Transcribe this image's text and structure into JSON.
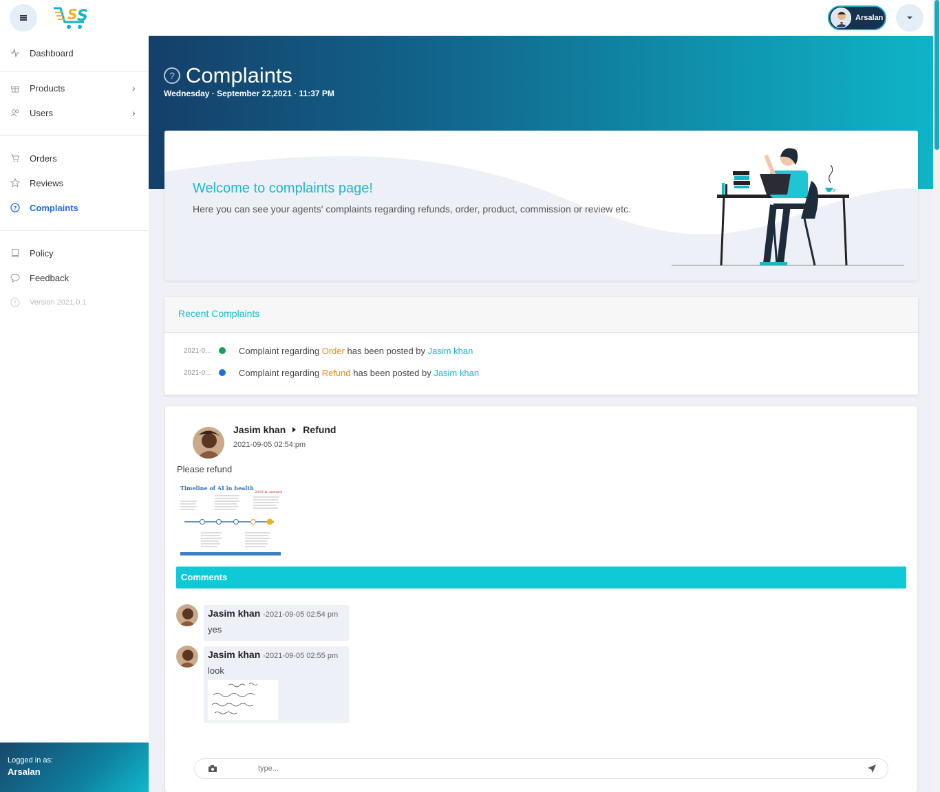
{
  "header": {
    "user_name": "Arsalan"
  },
  "sidebar": {
    "items": [
      {
        "label": "Dashboard",
        "icon": "pulse-icon"
      },
      {
        "label": "Products",
        "icon": "gift-icon",
        "has_submenu": true
      },
      {
        "label": "Users",
        "icon": "users-icon",
        "has_submenu": true
      },
      {
        "label": "Orders",
        "icon": "cart-icon"
      },
      {
        "label": "Reviews",
        "icon": "star-icon"
      },
      {
        "label": "Complaints",
        "icon": "help-circle-icon",
        "active": true
      },
      {
        "label": "Policy",
        "icon": "book-icon"
      },
      {
        "label": "Feedback",
        "icon": "chat-icon"
      },
      {
        "label": "Version 2021.0.1",
        "icon": "info-icon"
      }
    ],
    "logged_in_label": "Logged in as:",
    "logged_in_user": "Arsalan"
  },
  "page": {
    "title": "Complaints",
    "date": "Wednesday · September 22,2021 · 11:37 PM"
  },
  "welcome": {
    "heading": "Welcome to complaints page!",
    "text": "Here you can see your agents' complaints regarding refunds, order, product, commission or review etc."
  },
  "recent": {
    "title": "Recent Complaints",
    "items": [
      {
        "date": "2021-0...",
        "prefix": "Complaint regarding ",
        "type": "Order",
        "middle": " has been posted by ",
        "author": "Jasim khan",
        "dot_color": "#16a05a"
      },
      {
        "date": "2021-0...",
        "prefix": "Complaint regarding ",
        "type": "Refund",
        "middle": " has been posted by ",
        "author": "Jasim khan",
        "dot_color": "#1f6fe0"
      }
    ]
  },
  "complaint": {
    "author": "Jasim khan",
    "category": "Refund",
    "posted_at": "2021-09-05 02:54:pm",
    "message": "Please refund",
    "attachment_title": "Timeline of AI in health",
    "comments_label": "Comments",
    "comments": [
      {
        "author": "Jasim khan",
        "time": "-2021-09-05 02:54 pm",
        "text": "yes"
      },
      {
        "author": "Jasim khan",
        "time": "-2021-09-05 02:55 pm",
        "text": "look"
      }
    ],
    "input_placeholder": "type..."
  },
  "colors": {
    "accent": "#1bb9cd",
    "active_nav": "#1f6fd8",
    "orange": "#e48a1c"
  }
}
